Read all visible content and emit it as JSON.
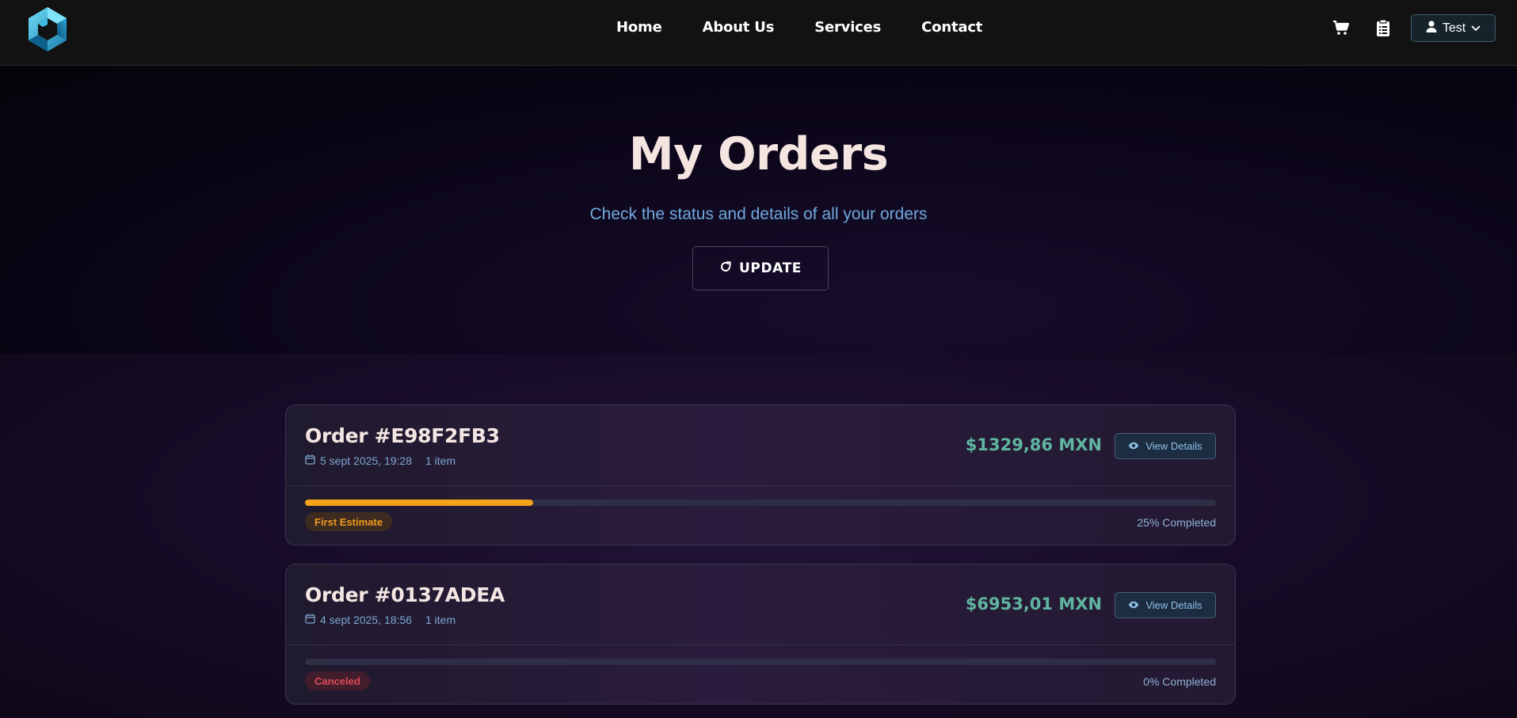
{
  "nav": {
    "links": [
      "Home",
      "About Us",
      "Services",
      "Contact"
    ],
    "user_label": "Test",
    "icons": [
      "cart-icon",
      "clipboard-icon",
      "user-icon",
      "chevron-down-icon"
    ]
  },
  "hero": {
    "title": "My Orders",
    "subtitle": "Check the status and details of all your orders",
    "update_label": "UPDATE"
  },
  "orders": [
    {
      "title": "Order #E98F2FB3",
      "date": "5 sept 2025, 19:28",
      "items": "1 item",
      "price": "$1329,86 MXN",
      "view_label": "View Details",
      "progress": 25,
      "status": "First Estimate",
      "completed": "25% Completed"
    },
    {
      "title": "Order #0137ADEA",
      "date": "4 sept 2025, 18:56",
      "items": "1 item",
      "price": "$6953,01 MXN",
      "view_label": "View Details",
      "progress": 0,
      "status": "Canceled",
      "completed": "0% Completed"
    }
  ],
  "colors": {
    "accent_price": "#5fb59f",
    "progress": "#f5a21a",
    "status_estimate": "#f09a20",
    "status_canceled": "#e0485a",
    "subtitle": "#6fa9dd"
  }
}
